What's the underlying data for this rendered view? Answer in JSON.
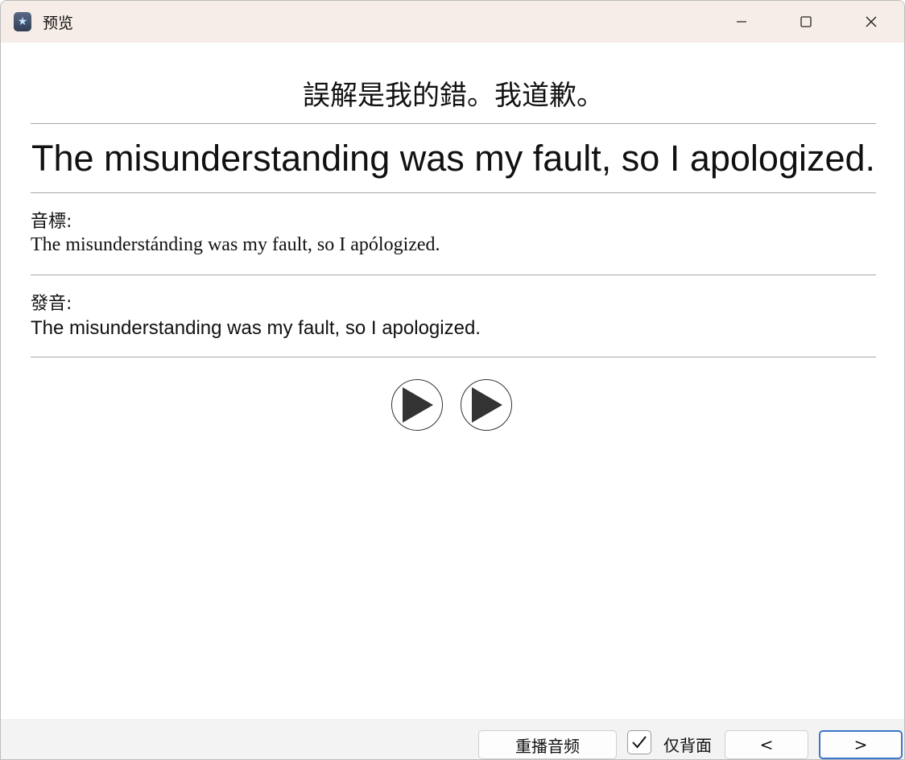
{
  "window": {
    "title": "预览",
    "icon": "app-star-icon",
    "controls": [
      "minimize-icon",
      "maximize-icon",
      "close-icon"
    ]
  },
  "card": {
    "front": "誤解是我的錯。我道歉。",
    "english": "The misunderstanding was my fault, so I apologized.",
    "phonetic_label": "音標:",
    "phonetic_text": "The misunderstánding was my fault, so I apólogized.",
    "pronunciation_label": "發音:",
    "pronunciation_text": "The misunderstanding was my fault, so I apologized.",
    "audio_buttons": [
      "play-icon",
      "play-icon"
    ]
  },
  "bottombar": {
    "replay_label": "重播音频",
    "backside_only_label": "仅背面",
    "backside_only_checked": true,
    "prev_label": "<",
    "next_label": ">"
  }
}
